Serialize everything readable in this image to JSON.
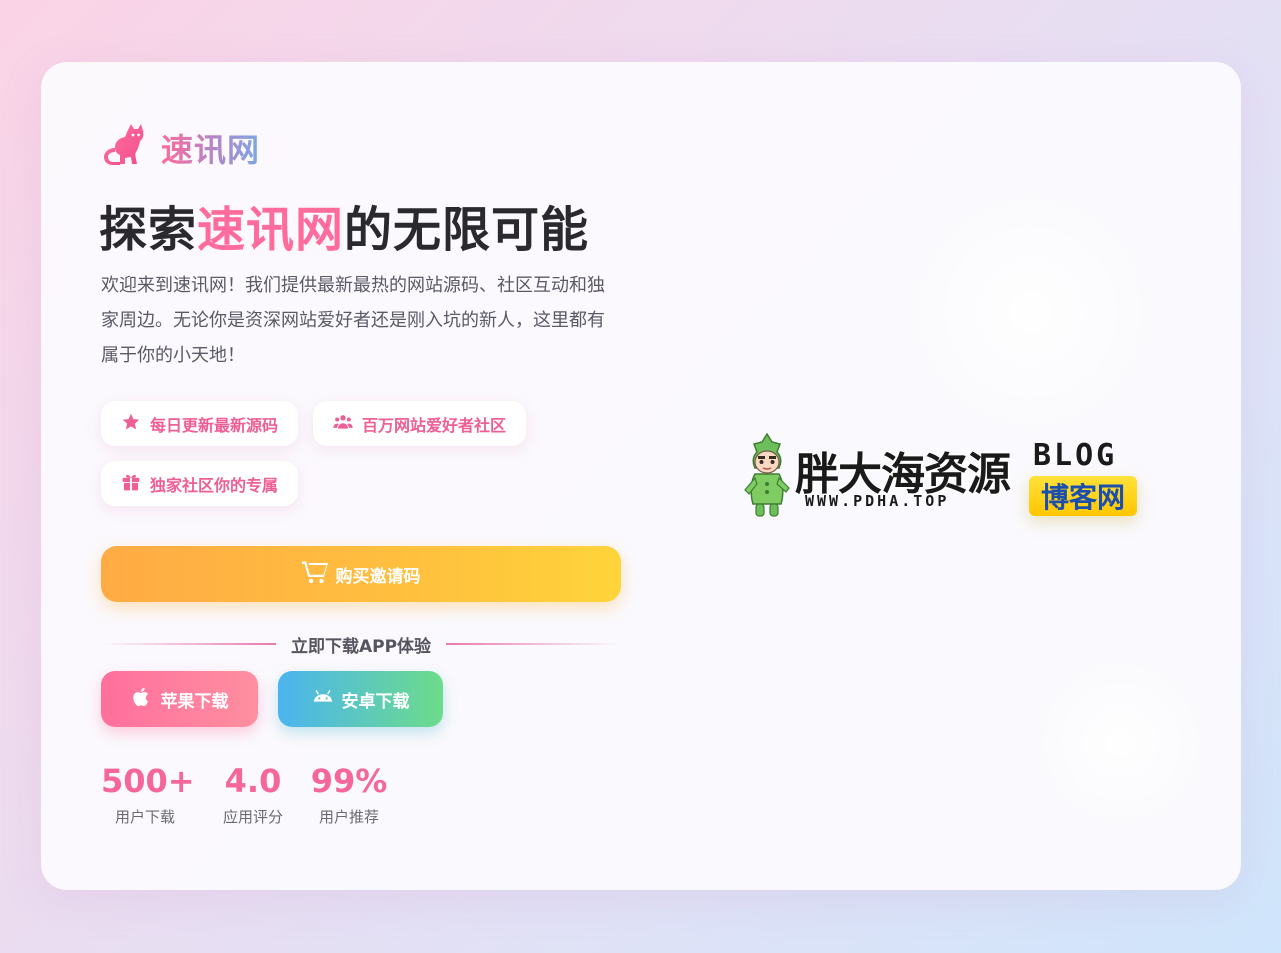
{
  "brand": {
    "name": "速讯网",
    "icon": "cat-icon",
    "accent": "#ff6b9b"
  },
  "headline": {
    "prefix": "探索",
    "highlight": "速讯网",
    "suffix": "的无限可能"
  },
  "intro": "欢迎来到速讯网！我们提供最新最热的网站源码、社区互动和独家周边。无论你是资深网站爱好者还是刚入坑的新人，这里都有属于你的小天地！",
  "tags": [
    {
      "icon": "star-icon",
      "label": "每日更新最新源码"
    },
    {
      "icon": "users-icon",
      "label": "百万网站爱好者社区"
    },
    {
      "icon": "gift-icon",
      "label": "独家社区你的专属"
    }
  ],
  "buy_button": {
    "icon": "cart-icon",
    "label": "购买邀请码"
  },
  "download": {
    "divider_text": "立即下载APP体验",
    "ios_label": "苹果下载",
    "android_label": "安卓下载"
  },
  "stats": [
    {
      "value": "500+",
      "label": "用户下载"
    },
    {
      "value": "4.0",
      "label": "应用评分"
    },
    {
      "value": "99%",
      "label": "用户推荐"
    }
  ],
  "side_logo": {
    "title": "胖大海资源",
    "url": "WWW.PDHA.TOP",
    "blog": "BLOG",
    "badge": "博客网"
  }
}
